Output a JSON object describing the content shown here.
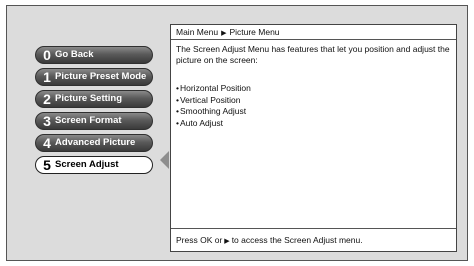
{
  "menu": {
    "items": [
      {
        "number": "0",
        "label": "Go Back",
        "selected": false
      },
      {
        "number": "1",
        "label": "Picture Preset Mode",
        "selected": false
      },
      {
        "number": "2",
        "label": "Picture Setting",
        "selected": false
      },
      {
        "number": "3",
        "label": "Screen Format",
        "selected": false
      },
      {
        "number": "4",
        "label": "Advanced Picture",
        "selected": false
      },
      {
        "number": "5",
        "label": "Screen Adjust",
        "selected": true
      }
    ]
  },
  "panel": {
    "breadcrumb": {
      "root": "Main Menu",
      "separator_icon": "right-triangle-icon",
      "current": "Picture Menu"
    },
    "description": "The Screen Adjust Menu has features that let you position and adjust the picture on the screen:",
    "features": [
      "Horizontal Position",
      "Vertical Position",
      "Smoothing Adjust",
      "Auto Adjust"
    ],
    "footer": {
      "prefix": "Press OK or",
      "arrow_icon": "right-triangle-icon",
      "suffix": "to access the Screen Adjust menu."
    }
  },
  "colors": {
    "screen_background": "#dcdcdc",
    "button_gradient_top": "#8a8a8a",
    "button_gradient_bottom": "#3a3a3a",
    "selected_button": "#ffffff",
    "pointer": "#8e8e8e"
  }
}
